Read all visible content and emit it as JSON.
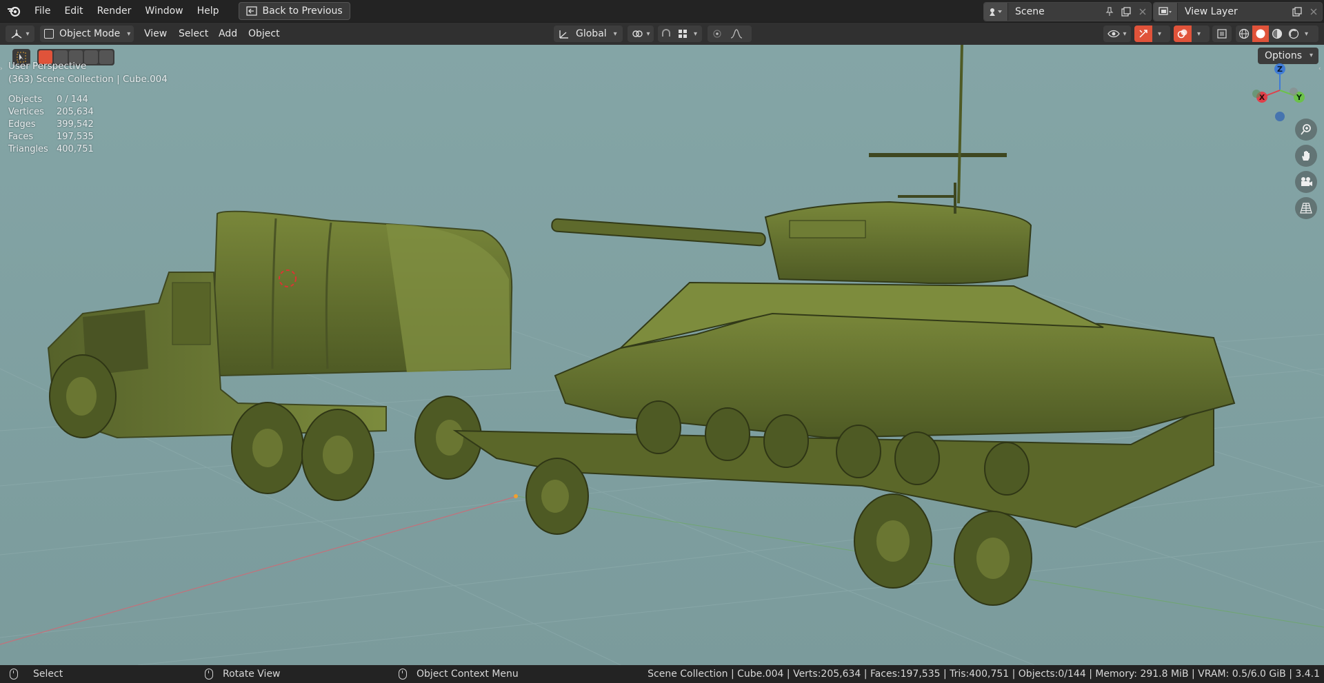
{
  "menu": {
    "items": [
      "File",
      "Edit",
      "Render",
      "Window",
      "Help"
    ],
    "back_button": "Back to Previous"
  },
  "scene": {
    "name": "Scene"
  },
  "view_layer": {
    "name": "View Layer"
  },
  "header": {
    "mode": "Object Mode",
    "menus": [
      "View",
      "Select",
      "Add",
      "Object"
    ],
    "transform_orientation": "Global",
    "options": "Options"
  },
  "viewport": {
    "perspective": "User Perspective",
    "collection": "(363) Scene Collection | Cube.004",
    "stats": [
      {
        "label": "Objects",
        "value": "0 / 144"
      },
      {
        "label": "Vertices",
        "value": "205,634"
      },
      {
        "label": "Edges",
        "value": "399,542"
      },
      {
        "label": "Faces",
        "value": "197,535"
      },
      {
        "label": "Triangles",
        "value": "400,751"
      }
    ],
    "gizmo": {
      "x": "X",
      "y": "Y",
      "z": "Z"
    },
    "colors": {
      "background": "#7f9fa0",
      "model": "#5e6a2c",
      "x_axis": "#e0404a",
      "y_axis": "#6cc24a",
      "z_axis": "#3f7bd6"
    }
  },
  "status": {
    "hints": [
      "Select",
      "Rotate View",
      "Object Context Menu"
    ],
    "info": "Scene Collection | Cube.004 | Verts:205,634 | Faces:197,535 | Tris:400,751 | Objects:0/144 | Memory: 291.8 MiB | VRAM: 0.5/6.0 GiB | 3.4.1"
  }
}
